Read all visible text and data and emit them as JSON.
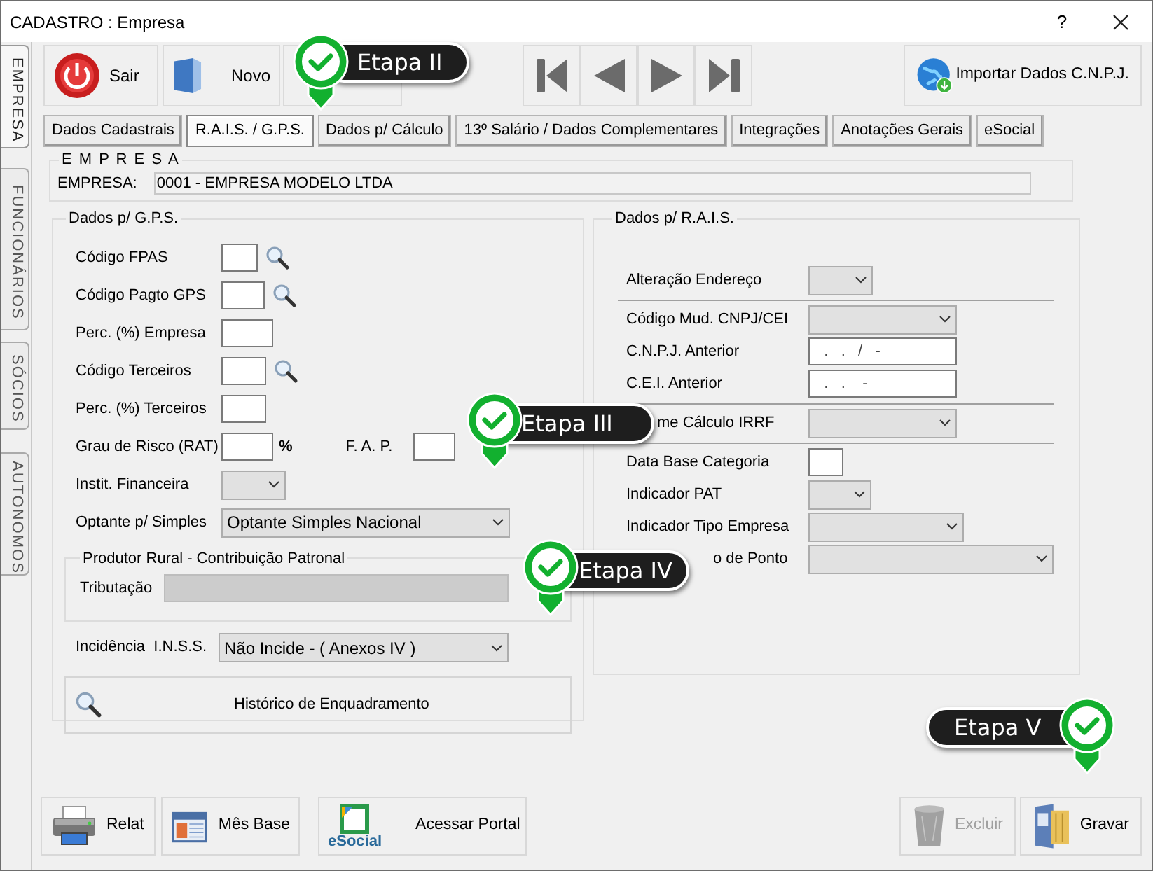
{
  "window": {
    "title": "CADASTRO : Empresa",
    "help": "?"
  },
  "side_tabs": [
    {
      "label": "EMPRESA",
      "selected": true
    },
    {
      "label": "FUNCIONÁRIOS",
      "selected": false
    },
    {
      "label": "SÓCIOS",
      "selected": false
    },
    {
      "label": "AUTONOMOS",
      "selected": false
    }
  ],
  "toolbar": {
    "buttons": [
      {
        "kind": "exit",
        "label": "Sair"
      },
      {
        "kind": "new",
        "label": "Novo"
      },
      {
        "kind": "covered"
      }
    ],
    "import_button": {
      "label": "Importar Dados C.N.P.J."
    }
  },
  "tabs": [
    {
      "label": "Dados Cadastrais",
      "selected": false
    },
    {
      "label": "R.A.I.S. / G.P.S.",
      "selected": true
    },
    {
      "label": "Dados p/ Cálculo",
      "selected": false
    },
    {
      "label": "13º Salário / Dados Complementares",
      "selected": false
    },
    {
      "label": "Integrações",
      "selected": false
    },
    {
      "label": "Anotações Gerais",
      "selected": false
    },
    {
      "label": "eSocial",
      "selected": false
    }
  ],
  "empresa": {
    "title": "E M P R E S A",
    "label": "EMPRESA:",
    "value": "0001 - EMPRESA MODELO LTDA"
  },
  "gps": {
    "title": "Dados p/ G.P.S.",
    "rows": [
      {
        "kind": "input",
        "label": "Código FPAS",
        "search": true
      },
      {
        "kind": "input",
        "label": "Código Pagto GPS",
        "search": true
      },
      {
        "kind": "input",
        "label": "Perc. (%) Empresa",
        "search": false
      },
      {
        "kind": "input",
        "label": "Código Terceiros",
        "search": true
      },
      {
        "kind": "input",
        "label": "Perc. (%) Terceiros",
        "search": false
      },
      {
        "kind": "rat",
        "label": "Grau de Risco (RAT)",
        "suffix": "%",
        "second_label": "F. A. P."
      },
      {
        "kind": "select",
        "label": "Instit. Financeira"
      },
      {
        "kind": "select",
        "label": "Optante p/ Simples",
        "value": "Optante Simples Nacional"
      }
    ],
    "produtor": {
      "title": "Produtor Rural - Contribuição Patronal",
      "label": "Tributação"
    },
    "incidencia": {
      "label": "Incidência  I.N.S.S.",
      "value": "Não Incide - ( Anexos IV )"
    },
    "history_button": {
      "label": "Histórico de Enquadramento"
    }
  },
  "rais": {
    "title": "Dados p/ R.A.I.S.",
    "sections": [
      [
        {
          "kind": "select",
          "label": "Alteração Endereço"
        }
      ],
      [
        {
          "kind": "select",
          "label": "Código Mud. CNPJ/CEI"
        },
        {
          "kind": "masked",
          "label": "C.N.P.J. Anterior",
          "value": "  .   .   /   -"
        },
        {
          "kind": "masked",
          "label": "C.E.I. Anterior",
          "value": "  .   .    -"
        }
      ],
      [
        {
          "kind": "select",
          "label": "me Cálculo IRRF"
        }
      ],
      [
        {
          "kind": "input",
          "label": "Data Base Categoria"
        },
        {
          "kind": "select",
          "label": "Indicador PAT"
        },
        {
          "kind": "select",
          "label": "Indicador Tipo Empresa"
        },
        {
          "kind": "select",
          "label": "o de Ponto"
        }
      ]
    ]
  },
  "bottom_left": [
    {
      "kind": "printer",
      "label": "Relat",
      "disabled": false
    },
    {
      "kind": "calendar",
      "label": "Mês Base",
      "disabled": false
    },
    {
      "kind": "esocial",
      "label": "Acessar Portal",
      "logo_text": "eSocial",
      "disabled": false
    }
  ],
  "bottom_right": [
    {
      "kind": "trash",
      "label": "Excluir",
      "disabled": true
    },
    {
      "kind": "save",
      "label": "Gravar",
      "disabled": false
    }
  ],
  "callouts": [
    {
      "label": "Etapa II"
    },
    {
      "label": "Etapa III"
    },
    {
      "label": "Etapa IV"
    },
    {
      "label": "Etapa V"
    }
  ]
}
